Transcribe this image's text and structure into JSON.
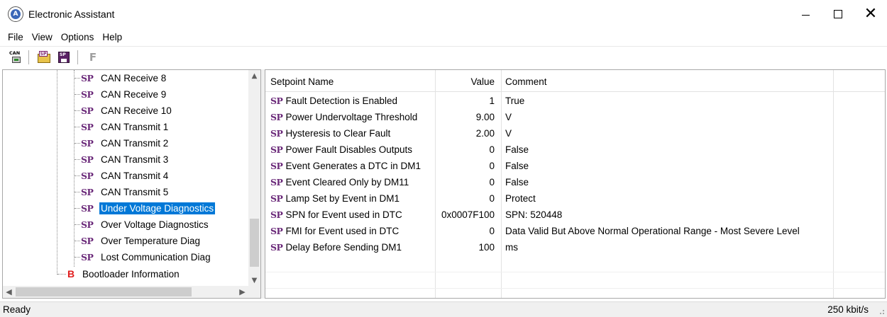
{
  "window": {
    "title": "Electronic Assistant",
    "app_icon_letter": "A",
    "close_glyph": "✕"
  },
  "menu": [
    "File",
    "View",
    "Options",
    "Help"
  ],
  "toolbar": {
    "can_label": "CAN",
    "sp_label": "SP",
    "f_label": "F"
  },
  "tree": {
    "sp_badge": "SP",
    "items": [
      "CAN Receive 8",
      "CAN Receive 9",
      "CAN Receive 10",
      "CAN Transmit 1",
      "CAN Transmit 2",
      "CAN Transmit 3",
      "CAN Transmit 4",
      "CAN Transmit 5",
      "Under Voltage Diagnostics",
      "Over Voltage Diagnostics",
      "Over Temperature Diag",
      "Lost Communication Diag"
    ],
    "selected_index": 8,
    "bootloader_badge": "B",
    "bootloader_label": "Bootloader Information"
  },
  "grid": {
    "headers": {
      "name": "Setpoint Name",
      "value": "Value",
      "comment": "Comment"
    },
    "sp_badge": "SP",
    "rows": [
      {
        "name": "Fault Detection is Enabled",
        "value": "1",
        "comment": "True"
      },
      {
        "name": "Power Undervoltage Threshold",
        "value": "9.00",
        "comment": "V"
      },
      {
        "name": "Hysteresis to Clear Fault",
        "value": "2.00",
        "comment": "V"
      },
      {
        "name": "Power Fault Disables Outputs",
        "value": "0",
        "comment": "False"
      },
      {
        "name": "Event Generates a DTC in DM1",
        "value": "0",
        "comment": "False"
      },
      {
        "name": "Event Cleared Only by DM11",
        "value": "0",
        "comment": "False"
      },
      {
        "name": "Lamp Set by Event in DM1",
        "value": "0",
        "comment": "Protect"
      },
      {
        "name": "SPN for Event used in DTC",
        "value": "0x0007F100",
        "comment": "SPN: 520448"
      },
      {
        "name": "FMI for Event used in DTC",
        "value": "0",
        "comment": "Data Valid But Above Normal Operational Range - Most Severe Level"
      },
      {
        "name": "Delay Before Sending DM1",
        "value": "100",
        "comment": "ms"
      }
    ]
  },
  "status": {
    "text": "Ready",
    "baud": "250 kbit/s"
  },
  "colors": {
    "selection": "#0078d7",
    "sp_badge": "#6b2a7a",
    "bootloader_badge": "#e01c1c"
  }
}
